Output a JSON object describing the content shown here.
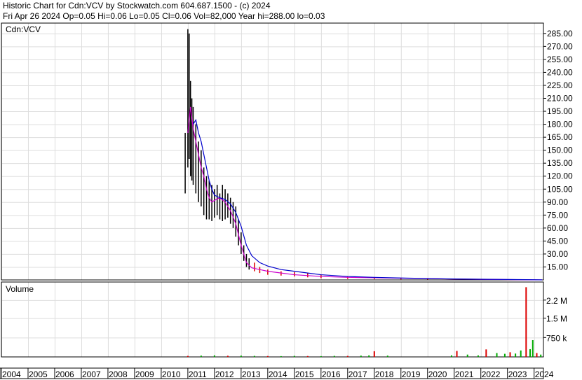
{
  "header": {
    "line1": "Historic Chart for Cdn:VCV by Stockwatch.com 604.687.1500 - (c) 2024",
    "line2": "Fri Apr 26 2024   Op=0.05  Hi=0.06  Lo=0.05  Cl=0.06  Vol=82,000  Year hi=288.00  lo=0.03"
  },
  "colors": {
    "grid": "#dddddd",
    "frame": "#000000",
    "price_bar": "#000000",
    "price_down": "#dd0000",
    "ma_short": "#cc00cc",
    "ma_long": "#0000cc",
    "volume_up": "#00aa00",
    "volume_down": "#dd0000"
  },
  "chart_data": [
    {
      "type": "line",
      "symbol_label": "Cdn:VCV",
      "ylim": [
        0,
        297
      ],
      "y_ticks": [
        "285.00",
        "270.00",
        "255.00",
        "240.00",
        "225.00",
        "210.00",
        "195.00",
        "180.00",
        "165.00",
        "150.00",
        "135.00",
        "120.00",
        "105.00",
        "90.00",
        "75.00",
        "60.00",
        "45.00",
        "30.00",
        "15.00"
      ],
      "y_tick_values": [
        285,
        270,
        255,
        240,
        225,
        210,
        195,
        180,
        165,
        150,
        135,
        120,
        105,
        90,
        75,
        60,
        45,
        30,
        15
      ],
      "x_ticks": [
        "2004",
        "2005",
        "2006",
        "2007",
        "2008",
        "2009",
        "2010",
        "2011",
        "2012",
        "2013",
        "2014",
        "2015",
        "2016",
        "2017",
        "2018",
        "2019",
        "2020",
        "2021",
        "2022",
        "2023",
        "2024"
      ],
      "x_tick_values": [
        2004,
        2005,
        2006,
        2007,
        2008,
        2009,
        2010,
        2011,
        2012,
        2013,
        2014,
        2015,
        2016,
        2017,
        2018,
        2019,
        2020,
        2021,
        2022,
        2023,
        2024
      ],
      "xlim": [
        2004,
        2024.35
      ],
      "grid": true,
      "series": [
        {
          "kind": "price_range",
          "x": [
            2010.9,
            2011.0,
            2011.05,
            2011.1,
            2011.15,
            2011.2,
            2011.3,
            2011.4,
            2011.5,
            2011.6,
            2011.7,
            2011.8,
            2011.9,
            2012.0,
            2012.1,
            2012.2,
            2012.3,
            2012.4,
            2012.5,
            2012.6,
            2012.7,
            2012.8,
            2012.9,
            2013.0,
            2013.1,
            2013.2,
            2013.3,
            2013.5,
            2013.7,
            2014.0,
            2014.5,
            2015.0,
            2015.5,
            2016.0,
            2017.0,
            2018.0,
            2019.0,
            2020.0,
            2021.0,
            2022.0,
            2023.0,
            2024.3
          ],
          "high": [
            170,
            290,
            285,
            230,
            210,
            200,
            180,
            160,
            150,
            130,
            120,
            115,
            110,
            105,
            110,
            100,
            110,
            105,
            100,
            95,
            90,
            85,
            70,
            55,
            40,
            30,
            25,
            20,
            15,
            12,
            10,
            9,
            8,
            6,
            4,
            3,
            2,
            1.5,
            1,
            0.8,
            0.5,
            0.06
          ],
          "low": [
            100,
            130,
            140,
            120,
            115,
            110,
            100,
            90,
            85,
            75,
            70,
            70,
            68,
            72,
            75,
            70,
            68,
            70,
            72,
            65,
            60,
            50,
            40,
            30,
            22,
            15,
            12,
            10,
            8,
            6,
            5,
            4,
            3,
            2,
            1.2,
            1,
            0.6,
            0.4,
            0.3,
            0.2,
            0.05,
            0.05
          ]
        },
        {
          "kind": "ma_short",
          "x": [
            2011.0,
            2011.1,
            2011.2,
            2011.3,
            2011.4,
            2011.5,
            2011.6,
            2011.7,
            2011.8,
            2011.9,
            2012.0,
            2012.2,
            2012.4,
            2012.6,
            2012.8,
            2013.0,
            2013.2,
            2013.4,
            2013.7,
            2014.0,
            2014.5,
            2015.0,
            2015.5,
            2016.0,
            2017.0,
            2018.0,
            2019.0,
            2020.0,
            2021.0,
            2022.0,
            2023.0,
            2024.3
          ],
          "y": [
            170,
            200,
            175,
            160,
            145,
            130,
            120,
            105,
            95,
            90,
            92,
            95,
            90,
            80,
            65,
            40,
            20,
            14,
            12,
            10,
            8,
            6,
            5,
            4,
            3,
            2.5,
            2,
            1.5,
            1,
            0.7,
            0.4,
            0.06
          ]
        },
        {
          "kind": "ma_long",
          "x": [
            2011.2,
            2011.3,
            2011.4,
            2011.5,
            2011.6,
            2011.7,
            2011.8,
            2011.9,
            2012.0,
            2012.2,
            2012.4,
            2012.6,
            2012.8,
            2013.0,
            2013.2,
            2013.4,
            2013.7,
            2014.0,
            2014.5,
            2015.0,
            2015.5,
            2016.0,
            2017.0,
            2018.0,
            2019.0,
            2020.0,
            2021.0,
            2022.0,
            2023.0,
            2024.3
          ],
          "y": [
            180,
            185,
            170,
            160,
            145,
            130,
            115,
            105,
            98,
            95,
            93,
            88,
            78,
            62,
            40,
            28,
            20,
            16,
            12,
            10,
            8,
            6,
            4,
            3,
            2.2,
            1.6,
            1.1,
            0.8,
            0.5,
            0.1
          ]
        }
      ]
    },
    {
      "type": "bar",
      "title": "Volume",
      "ylim": [
        0,
        2900000
      ],
      "y_ticks": [
        "2.2 M",
        "1.5 M",
        "750 k"
      ],
      "y_tick_values": [
        2200000,
        1500000,
        750000
      ],
      "xlim": [
        2004,
        2024.35
      ],
      "series": [
        {
          "name": "Volume",
          "x": [
            2011.0,
            2011.5,
            2012.0,
            2012.5,
            2013.0,
            2013.5,
            2014.0,
            2014.5,
            2015.0,
            2015.5,
            2016.0,
            2016.5,
            2017.0,
            2017.5,
            2017.8,
            2018.0,
            2018.5,
            2020.9,
            2021.1,
            2021.5,
            2021.9,
            2022.2,
            2022.6,
            2022.9,
            2023.1,
            2023.3,
            2023.5,
            2023.7,
            2023.85,
            2023.95,
            2024.1,
            2024.25
          ],
          "values": [
            40000,
            50000,
            60000,
            45000,
            50000,
            40000,
            35000,
            30000,
            40000,
            35000,
            30000,
            40000,
            40000,
            50000,
            60000,
            220000,
            50000,
            60000,
            230000,
            90000,
            60000,
            290000,
            150000,
            120000,
            180000,
            130000,
            250000,
            2700000,
            300000,
            650000,
            150000,
            90000
          ]
        }
      ]
    }
  ]
}
